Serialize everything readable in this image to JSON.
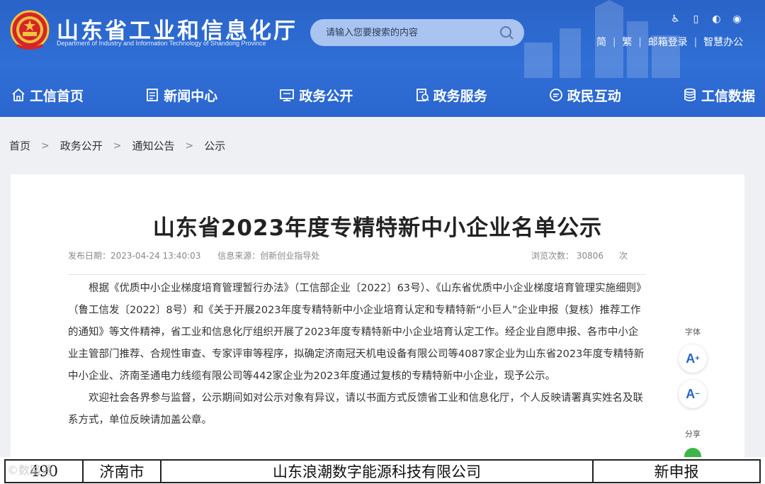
{
  "header": {
    "title": "山东省工业和信息化厅",
    "subtitle": "Department of Industry and Information Technology of Shandong Province",
    "search_placeholder": "请输入您要搜索的内容",
    "links": {
      "simplified": "简",
      "traditional": "繁",
      "mail": "邮箱登录",
      "smart_office": "智慧办公"
    },
    "tool_icons": [
      "accessibility-icon",
      "mobile-icon",
      "wechat-icon",
      "weibo-icon"
    ]
  },
  "nav": [
    {
      "label": "工信首页",
      "icon": "home-icon"
    },
    {
      "label": "新闻中心",
      "icon": "news-icon"
    },
    {
      "label": "政务公开",
      "icon": "gov-info-icon"
    },
    {
      "label": "政务服务",
      "icon": "service-icon"
    },
    {
      "label": "政民互动",
      "icon": "chat-icon"
    },
    {
      "label": "工信数据",
      "icon": "database-icon"
    }
  ],
  "breadcrumb": [
    "首页",
    "政务公开",
    "通知公告",
    "公示"
  ],
  "article": {
    "title": "山东省2023年度专精特新中小企业名单公示",
    "publish_date": "发布日期：2023-04-24 13:40:03",
    "source": "信息来源：创新创业指导处",
    "views_label": "浏览次数：",
    "views_count": "30806",
    "views_unit": "次",
    "paragraphs": [
      "根据《优质中小企业梯度培育管理暂行办法》（工信部企业〔2022〕63号）、《山东省优质中小企业梯度培育管理实施细则》（鲁工信发〔2022〕8号）和《关于开展2023年度专精特新中小企业培育认定和专精特新“小巨人”企业申报（复核）推荐工作的通知》等文件精神，省工业和信息化厅组织开展了2023年度专精特新中小企业培育认定工作。经企业自愿申报、各市中小企业主管部门推荐、合规性审查、专家评审等程序，拟确定济南冠天机电设备有限公司等4087家企业为山东省2023年度专精特新中小企业、济南圣通电力线缆有限公司等442家企业为2023年度通过复核的专精特新中小企业，现予公示。",
      "欢迎社会各界参与监督，公示期间如对公示对象有异议，请以书面方式反馈省工业和信息化厅，个人反映请署真实姓名及联系方式，单位反映请加盖公章。"
    ]
  },
  "side_tools": {
    "font_label": "字体",
    "font_larger": "A",
    "font_smaller": "A",
    "share_label": "分享"
  },
  "table_row": {
    "index": "490",
    "city": "济南市",
    "company": "山东浪潮数字能源科技有限公司",
    "type": "新申报"
  },
  "watermark": "©数路通"
}
